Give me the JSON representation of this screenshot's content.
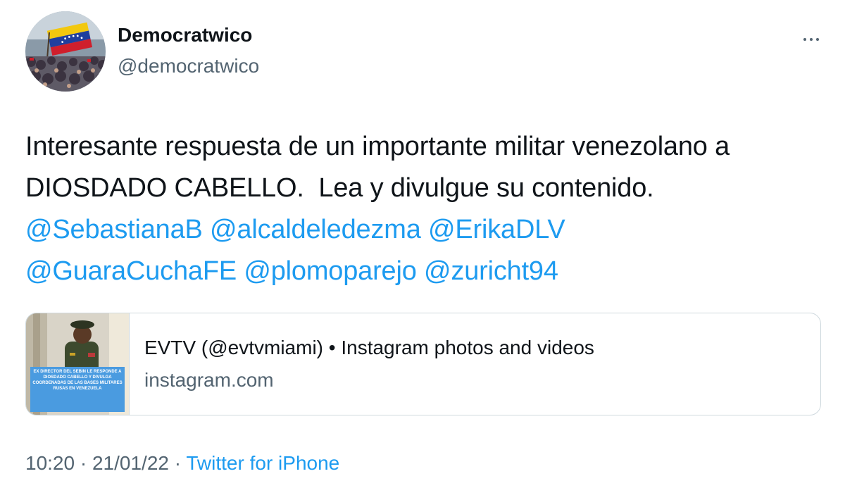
{
  "author": {
    "display_name": "Democratwico",
    "handle": "@democratwico",
    "avatar_icon": "venezuela-flag-crowd-avatar"
  },
  "more_icon": "more-horizontal-icon",
  "tweet": {
    "line1": "Interesante respuesta de un importante militar venezolano a",
    "line2": "DIOSDADO CABELLO.  Lea y divulgue su contenido.",
    "mentions": [
      "@SebastianaB",
      "@alcaldeledezma",
      "@ErikaDLV",
      "@GuaraCuchaFE",
      "@plomoparejo",
      "@zuricht94"
    ]
  },
  "card": {
    "title": "EVTV (@evtvmiami) • Instagram photos and videos",
    "domain": "instagram.com",
    "thumbnail_caption": "EX DIRECTOR DEL SEBIN LE RESPONDE A DIOSDADO CABELLO Y DIVULGA COORDENADAS DE LAS BASES MILITARES RUSAS EN VENEZUELA"
  },
  "meta": {
    "time": "10:20",
    "separator": " · ",
    "date": "21/01/22",
    "source": "Twitter for iPhone"
  },
  "colors": {
    "text": "#0f1419",
    "secondary": "#536471",
    "link": "#1d9bf0",
    "border": "#cfd9de"
  }
}
